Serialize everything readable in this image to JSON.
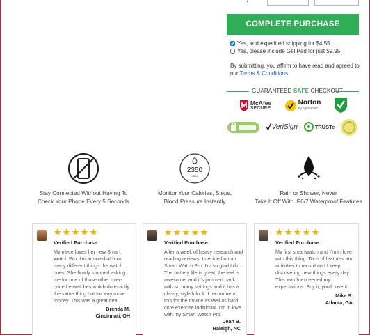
{
  "checkout": {
    "cta_label": "COMPLETE PURCHASE",
    "options": [
      {
        "label": "Yes, add expedited shipping for $4.55",
        "checked": true
      },
      {
        "label": "Yes, please include Gel Pad for just $9.95!",
        "checked": false
      }
    ],
    "agree_text": "By submitting, you affirm to have read and agreed to our",
    "terms_link": "Terms & Conditions",
    "guarantee": {
      "before": "GUARANTEED ",
      "safe": "SAFE",
      "after": " CHECKOUT"
    }
  },
  "badges": {
    "mcafee": {
      "name": "McAfee",
      "sub": "SECURE"
    },
    "norton": {
      "name": "Norton",
      "sub": "by Symantec"
    },
    "verisign": "VeriSign",
    "truste": "TRUSTe"
  },
  "features": [
    {
      "line1": "Stay Connected Without Having To",
      "line2": "Check Your Phone Every 5 Seconds"
    },
    {
      "line1": "Monitor Your Calories, Steps,",
      "line2": "Blood Pressure Instantly",
      "icon_value": "2350",
      "icon_unit": "KCAL"
    },
    {
      "line1": "Rain or Shower, Never",
      "line2": "Take It Off With IP6/7 Waterproof Features"
    }
  ],
  "reviews": [
    {
      "verified": "Verified Purchase",
      "text": "My niece loves her new Smart Watch Pro. I'm amazed at how many different things the watch does. She finally stopped asking me for one of those other over-priced e-watches which do exactly the same thing but for way more money. This was a great deal.",
      "name": "Brenda M.",
      "location": "Cincinnati, OH"
    },
    {
      "verified": "Verified Purchase",
      "text": "After a week of heavy research and reading reviews, I decided on an Smart Watch Pro. I'm so glad I did. The battery life is great, the feel is awesome, and it's jammed pack with so many settings and it has a classy, stylish look. I recommend this for the novice as well as hard core exercise individual. I'm in love with my Smart Watch Pro.",
      "name": "Jean B.",
      "location": "Raleigh, NC"
    },
    {
      "verified": "Verified Purchase",
      "text": "My first smartwatch and I'm in love with this thing. Tons of features and activities to record and I keep discovering new things every day. This watch exceeded my expectations. Buy it, you'll love it.",
      "name": "Mike S.",
      "location": "Atlanta, GA"
    }
  ],
  "colors": {
    "accent": "#2fae57",
    "star": "#f4b400",
    "link": "#1a5fb4",
    "border_red": "#c8202a"
  }
}
